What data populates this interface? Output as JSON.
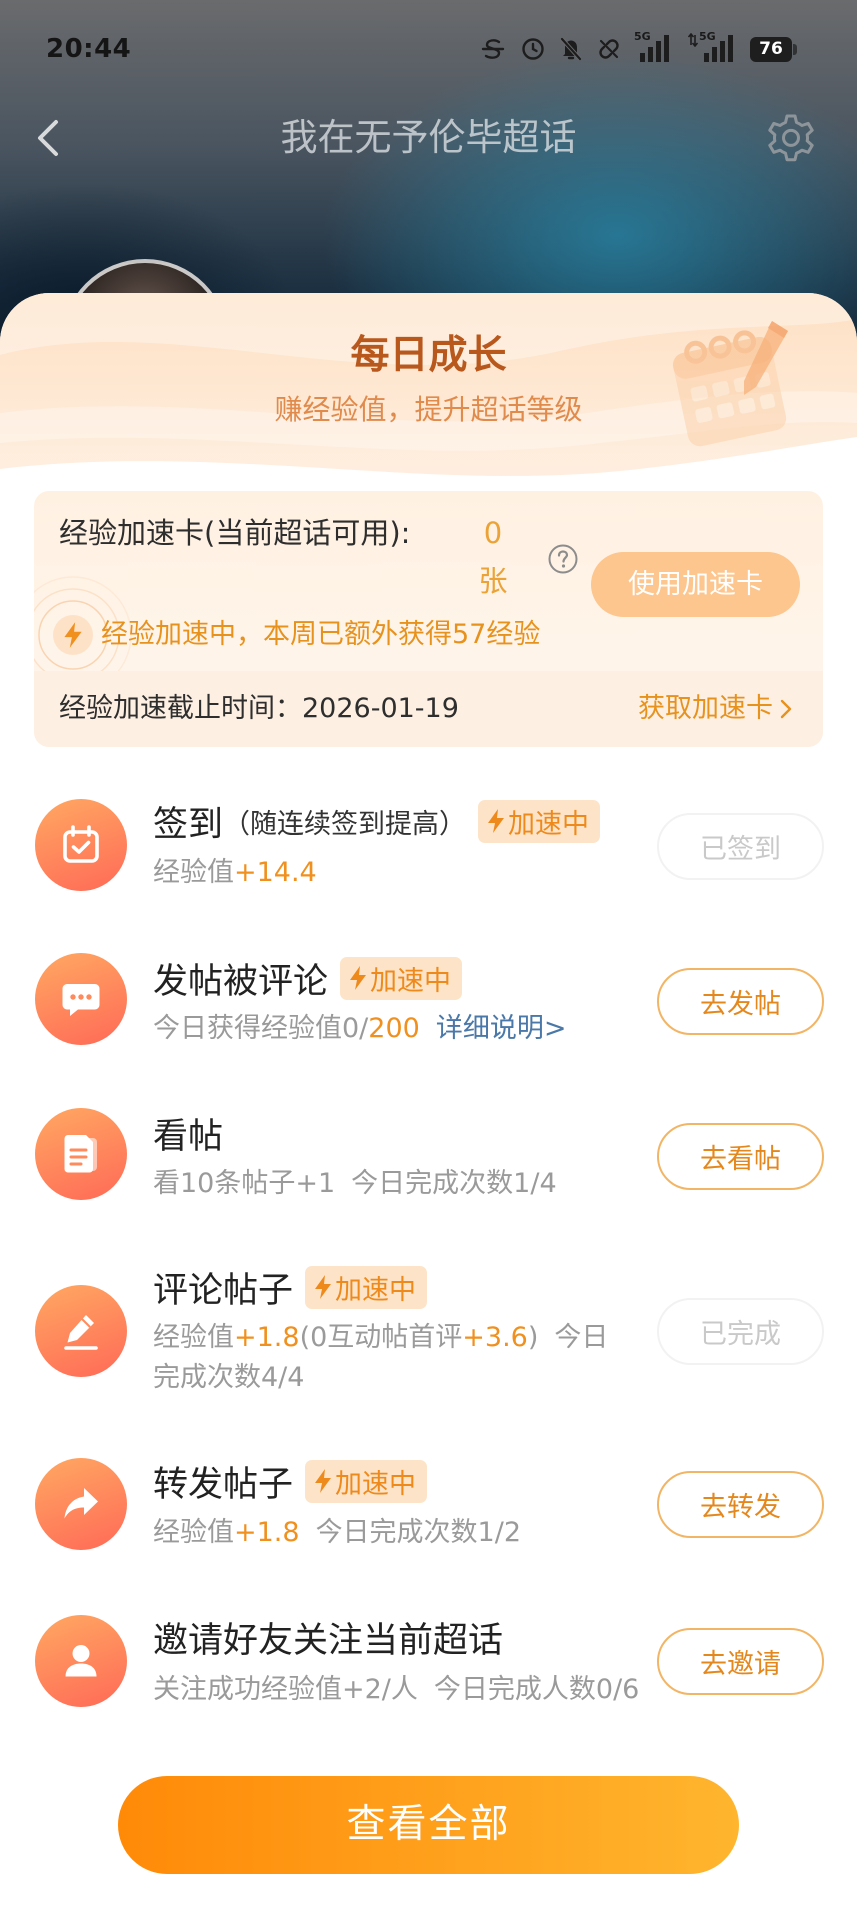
{
  "status_bar": {
    "time": "20:44",
    "network_1": "5G",
    "network_2": "5G",
    "battery": "76",
    "icons": [
      "data-saver-icon",
      "alarm-icon",
      "mute-icon",
      "link-off-icon",
      "signal-icon",
      "signal-icon",
      "battery-icon"
    ]
  },
  "header": {
    "title": "我在无予伦毕超话",
    "back_icon": "chevron-left-icon",
    "settings_icon": "gear-icon"
  },
  "growth": {
    "title": "每日成长",
    "subtitle": "赚经验值，提升超话等级"
  },
  "boost_card": {
    "label": "经验加速卡(当前超话可用):",
    "count": "0",
    "unit": "张",
    "use_button": "使用加速卡",
    "status": "经验加速中，本周已额外获得57经验",
    "deadline": "经验加速截止时间：2026-01-19",
    "get_link": "获取加速卡"
  },
  "tasks": [
    {
      "icon": "calendar-check-icon",
      "title": "签到",
      "note": "（随连续签到提高）",
      "badge": "加速中",
      "desc": [
        {
          "text": "经验值",
          "style": "muted"
        },
        {
          "text": "+14.4",
          "style": "accent"
        }
      ],
      "button": "已签到",
      "button_enabled": false
    },
    {
      "icon": "comment-icon",
      "title": "发帖被评论",
      "badge": "加速中",
      "desc": [
        {
          "text": "今日获得经验值0/",
          "style": "muted"
        },
        {
          "text": "200",
          "style": "accent"
        },
        {
          "text": "详细说明>",
          "style": "link"
        }
      ],
      "button": "去发帖",
      "button_enabled": true
    },
    {
      "icon": "document-icon",
      "title": "看帖",
      "desc": [
        {
          "text": "看10条帖子+1",
          "style": "muted"
        },
        {
          "text": "今日完成次数1/4",
          "style": "muted"
        }
      ],
      "button": "去看帖",
      "button_enabled": true
    },
    {
      "icon": "edit-icon",
      "title": "评论帖子",
      "badge": "加速中",
      "desc": [
        {
          "text": "经验值",
          "style": "muted"
        },
        {
          "text": "+1.8",
          "style": "accent"
        },
        {
          "text": "(0互动帖首评",
          "style": "muted"
        },
        {
          "text": "+3.6",
          "style": "accent"
        },
        {
          "text": ")",
          "style": "muted"
        },
        {
          "text": "今日完成次数4/4",
          "style": "muted"
        }
      ],
      "button": "已完成",
      "button_enabled": false
    },
    {
      "icon": "share-icon",
      "title": "转发帖子",
      "badge": "加速中",
      "desc": [
        {
          "text": "经验值",
          "style": "muted"
        },
        {
          "text": "+1.8",
          "style": "accent"
        },
        {
          "text": "今日完成次数1/2",
          "style": "muted"
        }
      ],
      "button": "去转发",
      "button_enabled": true
    },
    {
      "icon": "user-icon",
      "title": "邀请好友关注当前超话",
      "desc": [
        {
          "text": "关注成功经验值+2/人",
          "style": "muted"
        },
        {
          "text": "今日完成人数0/6",
          "style": "muted"
        }
      ],
      "button": "去邀请",
      "button_enabled": true
    }
  ],
  "view_all_button": "查看全部",
  "colors": {
    "accent": "#f0901e",
    "link": "#4a78a8",
    "title_brown": "#b8581c",
    "badge_bg": "#fde4c8",
    "primary_gradient_start": "#ff8a08",
    "primary_gradient_end": "#ffb52e",
    "icon_gradient_start": "#ffa862",
    "icon_gradient_end": "#ff6a57"
  }
}
